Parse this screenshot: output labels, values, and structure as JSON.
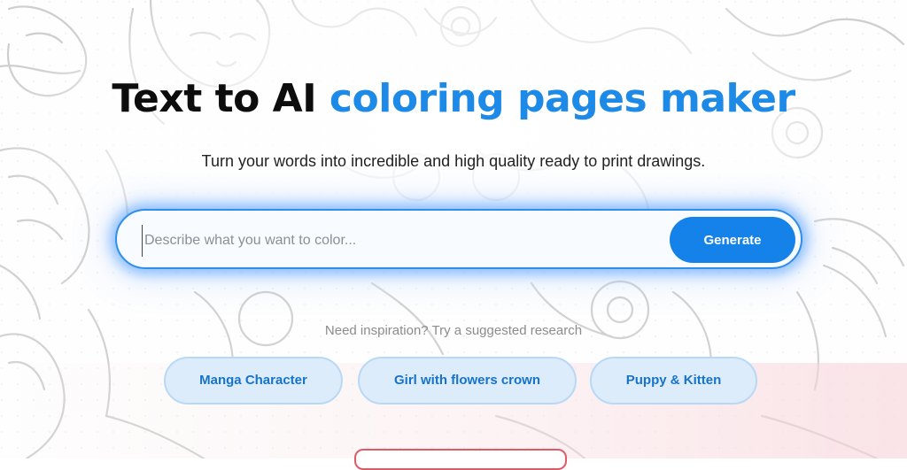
{
  "hero": {
    "title_dark": "Text to AI",
    "title_accent": "coloring pages maker",
    "subtitle": "Turn your words into incredible and high quality ready to print drawings."
  },
  "search": {
    "placeholder": "Describe what you want to color...",
    "value": "",
    "button_label": "Generate"
  },
  "suggestions": {
    "label": "Need inspiration? Try a suggested research",
    "items": [
      "Manga Character",
      "Girl with flowers crown",
      "Puppy & Kitten"
    ]
  },
  "colors": {
    "accent": "#1c8ae6",
    "button": "#1582ea",
    "chip_bg": "#dcecfb",
    "chip_text": "#1773c9"
  }
}
